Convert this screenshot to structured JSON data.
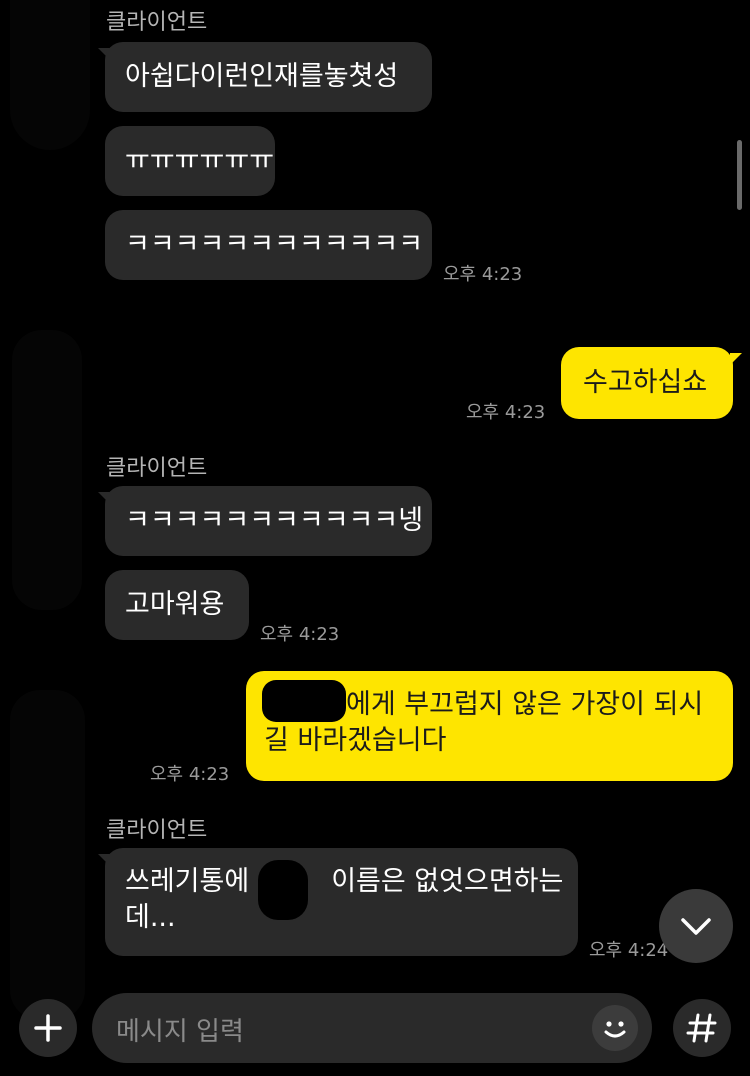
{
  "messages": {
    "sender1": "클라이언트",
    "m1": "아쉽다이런인재를놓쳣성",
    "m2": "ㅠㅠㅠㅠㅠㅠ",
    "m3": "ㅋㅋㅋㅋㅋㅋㅋㅋㅋㅋㅋㅋ",
    "t1": "오후 4:23",
    "m4": "수고하십쇼",
    "t2": "오후 4:23",
    "sender2": "클라이언트",
    "m5": "ㅋㅋㅋㅋㅋㅋㅋㅋㅋㅋㅋ넹",
    "m6": "고마워용",
    "t3": "오후 4:23",
    "m7_line1": "에게 부끄럽지 않은 가장이 되시",
    "m7_line2": "길 바라겠습니다",
    "t4": "오후 4:23",
    "sender3": "클라이언트",
    "m8_part1": "쓰레기통에",
    "m8_part2": "이름은 없엇으면하는",
    "m8_line2": "데...",
    "t5": "오후 4:24"
  },
  "input": {
    "placeholder": "메시지 입력"
  },
  "colors": {
    "background": "#000000",
    "incoming_bubble": "#2a2a2a",
    "outgoing_bubble": "#fee500"
  },
  "icons": [
    "plus-icon",
    "emoji-icon",
    "hashtag-icon",
    "chevron-down-icon"
  ]
}
